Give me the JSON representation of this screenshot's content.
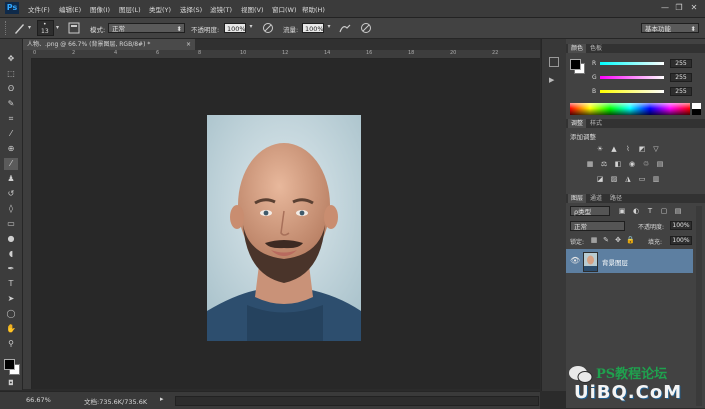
{
  "app": {
    "logo": "Ps"
  },
  "menu": [
    "文件(F)",
    "编辑(E)",
    "图像(I)",
    "图层(L)",
    "类型(Y)",
    "选择(S)",
    "滤镜(T)",
    "视图(V)",
    "窗口(W)",
    "帮助(H)"
  ],
  "window_controls": {
    "minimize": "—",
    "restore": "❐",
    "close": "✕"
  },
  "options": {
    "brush_size": "13",
    "mode_label": "模式:",
    "mode_value": "正常",
    "opacity_label": "不透明度:",
    "opacity_value": "100%",
    "flow_label": "流量:",
    "flow_value": "100%",
    "workspace": "基本功能"
  },
  "document": {
    "tab_title": "人物、.png @ 66.7% (背景图层, RGB/8#) *",
    "close": "×",
    "ruler_ticks": [
      "0",
      "2",
      "4",
      "6",
      "8",
      "10",
      "12",
      "14",
      "16",
      "18",
      "20",
      "22"
    ]
  },
  "status": {
    "zoom": "66.67%",
    "doc_info": "文档:735.6K/735.6K"
  },
  "color_panel": {
    "tabs": [
      "颜色",
      "色板"
    ],
    "channels": [
      {
        "label": "R",
        "value": "255"
      },
      {
        "label": "G",
        "value": "255"
      },
      {
        "label": "B",
        "value": "255"
      }
    ]
  },
  "adjustments_panel": {
    "tabs": [
      "调整",
      "样式"
    ],
    "title": "添加调整"
  },
  "layers_panel": {
    "tabs": [
      "图层",
      "通道",
      "路径"
    ],
    "filter_label": "ρ类型",
    "blend_mode": "正常",
    "opacity_label": "不透明度:",
    "opacity_value": "100%",
    "lock_label": "锁定:",
    "fill_label": "填充:",
    "fill_value": "100%",
    "layers": [
      {
        "name": "背景图层",
        "visible": true
      }
    ]
  },
  "watermark": {
    "text1": "PS教程论坛",
    "text2": "UiBQ.CoM"
  },
  "colors": {
    "accent_blue": "#5d7fa1",
    "ps_blue": "#31a8ff"
  }
}
